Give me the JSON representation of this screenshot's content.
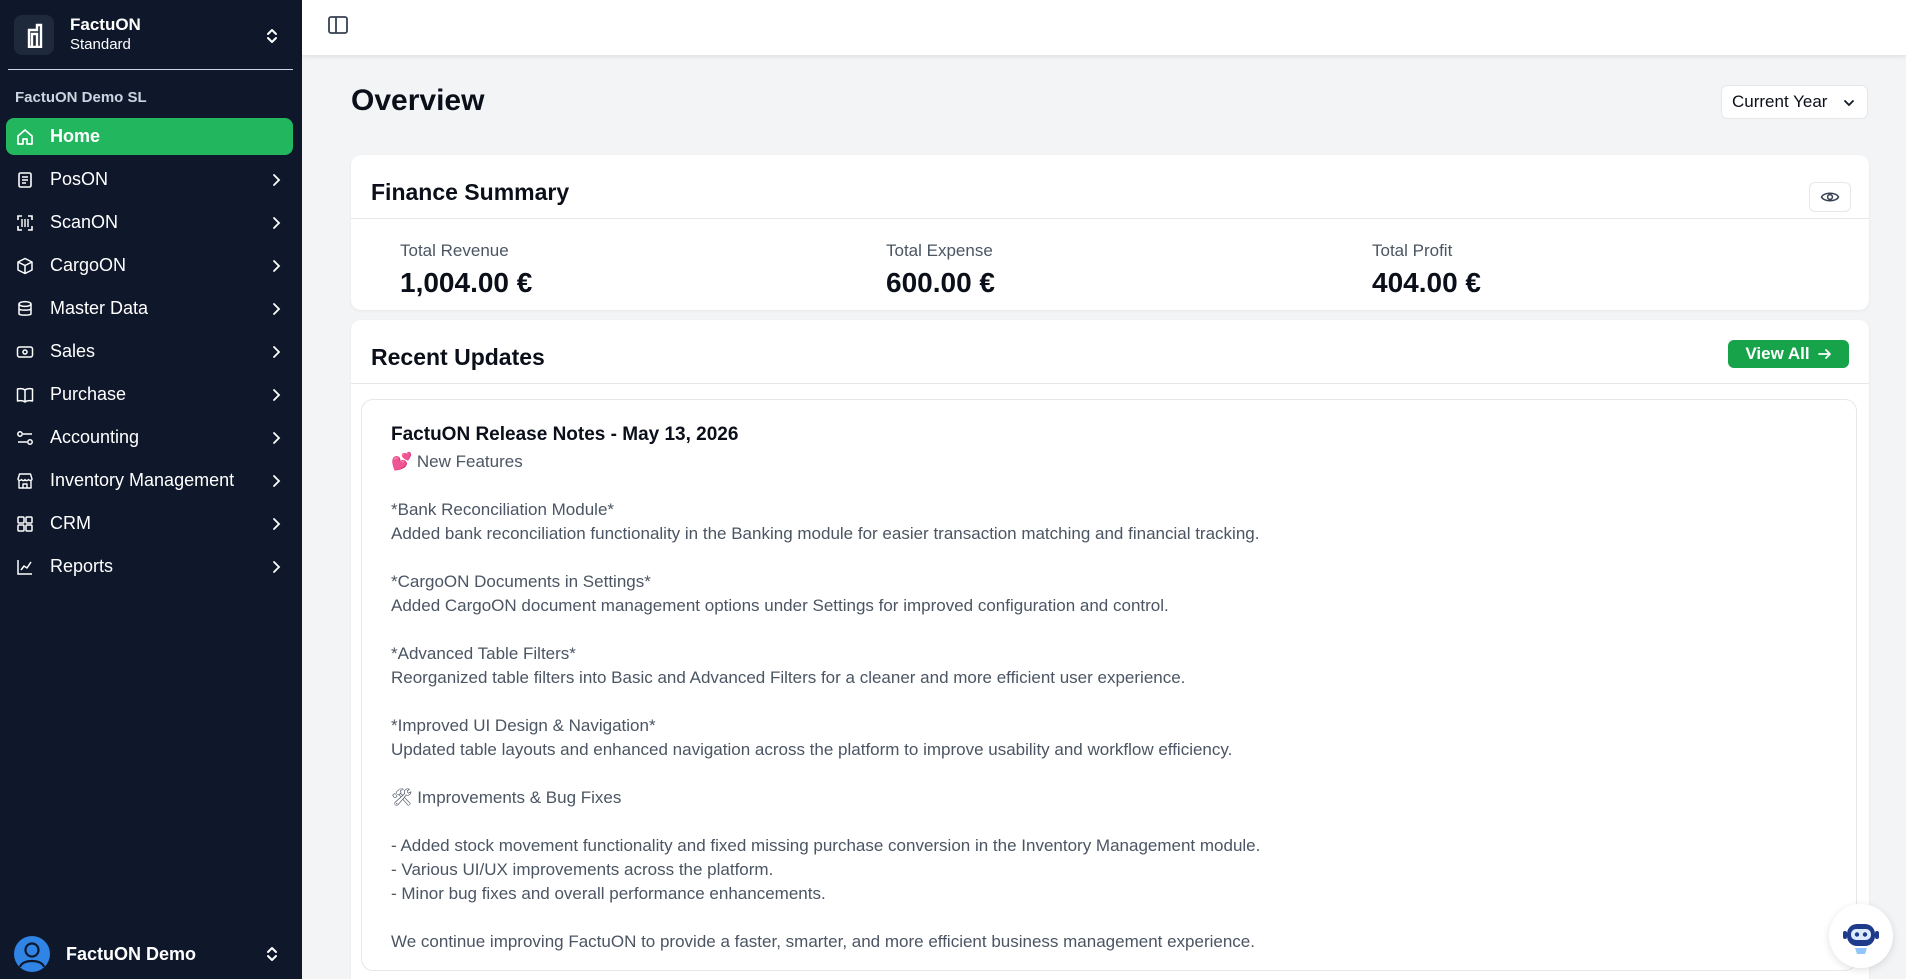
{
  "brand": {
    "name": "FactuON",
    "plan": "Standard"
  },
  "organization": "FactuON Demo SL",
  "nav": [
    {
      "label": "Home",
      "icon": "home-icon",
      "active": true
    },
    {
      "label": "PosON",
      "icon": "receipt-icon"
    },
    {
      "label": "ScanON",
      "icon": "scan-icon"
    },
    {
      "label": "CargoON",
      "icon": "package-icon"
    },
    {
      "label": "Master Data",
      "icon": "database-icon"
    },
    {
      "label": "Sales",
      "icon": "cash-icon"
    },
    {
      "label": "Purchase",
      "icon": "book-open-icon"
    },
    {
      "label": "Accounting",
      "icon": "sliders-icon"
    },
    {
      "label": "Inventory Management",
      "icon": "store-icon"
    },
    {
      "label": "CRM",
      "icon": "grid-icon"
    },
    {
      "label": "Reports",
      "icon": "chart-line-icon"
    }
  ],
  "user": {
    "name": "FactuON Demo"
  },
  "main": {
    "title": "Overview",
    "period": "Current Year"
  },
  "finance": {
    "title": "Finance Summary",
    "metrics": [
      {
        "label": "Total Revenue",
        "value": "1,004.00 €"
      },
      {
        "label": "Total Expense",
        "value": "600.00 €"
      },
      {
        "label": "Total Profit",
        "value": "404.00 €"
      }
    ]
  },
  "updates": {
    "title": "Recent Updates",
    "view_all": "View All",
    "note_title": "FactuON Release Notes - May 13, 2026",
    "lines": [
      "💕 New Features",
      "",
      "*Bank Reconciliation Module*",
      "Added bank reconciliation functionality in the Banking module for easier transaction matching and financial tracking.",
      "",
      "*CargoON Documents in Settings*",
      "Added CargoON document management options under Settings for improved configuration and control.",
      "",
      "*Advanced Table Filters*",
      "Reorganized table filters into Basic and Advanced Filters for a cleaner and more efficient user experience.",
      "",
      "*Improved UI Design & Navigation*",
      "Updated table layouts and enhanced navigation across the platform to improve usability and workflow efficiency.",
      "",
      "🛠 Improvements & Bug Fixes",
      "",
      "- Added stock movement functionality and fixed missing purchase conversion in the Inventory Management module.",
      "- Various UI/UX improvements across the platform.",
      "- Minor bug fixes and overall performance enhancements.",
      "",
      "We continue improving FactuON to provide a faster, smarter, and more efficient business management experience."
    ]
  },
  "colors": {
    "sidebar": "#0f172a",
    "accent": "#22b75e",
    "button": "#16a34a"
  }
}
